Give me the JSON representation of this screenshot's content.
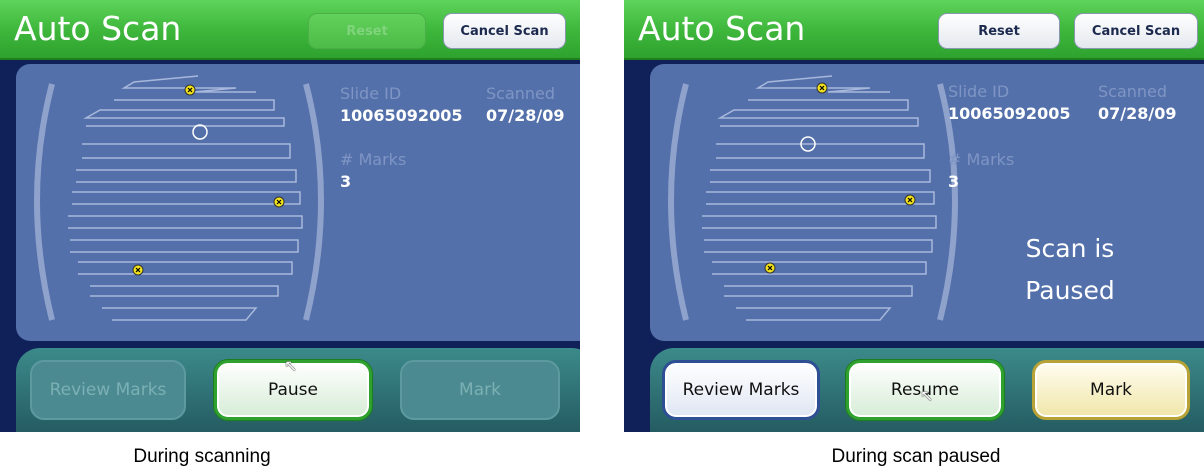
{
  "screens": [
    {
      "title": "Auto Scan",
      "reset_label": "Reset",
      "cancel_label": "Cancel Scan",
      "slide_id_label": "Slide ID",
      "slide_id_value": "10065092005",
      "scanned_label": "Scanned",
      "scanned_value": "07/28/09",
      "marks_label": "# Marks",
      "marks_value": "3",
      "review_label": "Review Marks",
      "center_label": "Pause",
      "mark_label": "Mark",
      "caption": "During scanning",
      "reset_enabled": false,
      "review_enabled": false,
      "mark_enabled": false
    },
    {
      "title": "Auto Scan",
      "reset_label": "Reset",
      "cancel_label": "Cancel Scan",
      "slide_id_label": "Slide ID",
      "slide_id_value": "10065092005",
      "scanned_label": "Scanned",
      "scanned_value": "07/28/09",
      "marks_label": "# Marks",
      "marks_value": "3",
      "paused_line1": "Scan is",
      "paused_line2": "Paused",
      "review_label": "Review Marks",
      "center_label": "Resume",
      "mark_label": "Mark",
      "caption": "During scan paused",
      "reset_enabled": true,
      "review_enabled": true,
      "mark_enabled": true
    }
  ],
  "colors": {
    "titlebar_green": "#3fb83d",
    "content_blue": "#5370aa",
    "bottom_teal": "#2f7479",
    "mark_yellow": "#f3e31a"
  },
  "icons": [
    "scan-position-marker-icon",
    "mark-x-icon",
    "mouse-pointer-icon"
  ]
}
